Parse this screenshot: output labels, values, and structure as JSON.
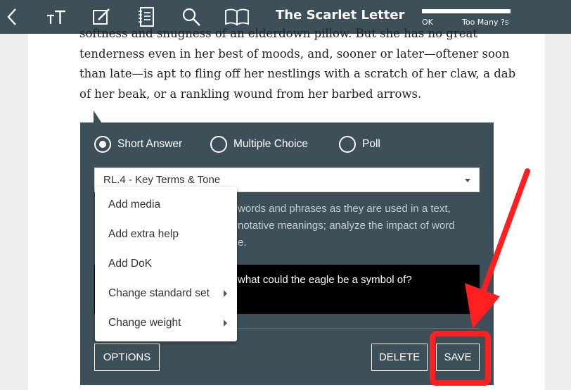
{
  "toolbar": {
    "title": "The Scarlet Letter",
    "icons": [
      "back-icon",
      "text-size-icon",
      "edit-icon",
      "notebook-icon",
      "search-icon",
      "book-icon"
    ],
    "meter": {
      "left_label": "OK",
      "right_label": "Too Many ?s",
      "level": 1.0
    }
  },
  "reading": {
    "lines": [
      "softness and snugness of an elderdown pillow. But she has no great",
      "tenderness even in her best of moods, and, sooner or later—oftener soon",
      "than late—is apt to fling off her nestlings with a scratch of her claw, a dab",
      "of her beak, or a rankling wound from her barbed arrows."
    ]
  },
  "question_editor": {
    "types": [
      {
        "label": "Short Answer",
        "selected": true
      },
      {
        "label": "Multiple Choice",
        "selected": false
      },
      {
        "label": "Poll",
        "selected": false
      }
    ],
    "standard": {
      "selected": "RL.4 - Key Terms & Tone"
    },
    "description_lines": [
      "words and phrases as they are used in a text,",
      "notative meanings; analyze the impact of word",
      "e."
    ],
    "prompt": "what could the eagle be a symbol of?",
    "buttons": {
      "options": "OPTIONS",
      "delete": "DELETE",
      "save": "SAVE"
    }
  },
  "options_menu": {
    "items": [
      {
        "label": "Add media",
        "has_submenu": false
      },
      {
        "label": "Add extra help",
        "has_submenu": false
      },
      {
        "label": "Add DoK",
        "has_submenu": false
      },
      {
        "label": "Change standard set",
        "has_submenu": true
      },
      {
        "label": "Change weight",
        "has_submenu": true
      }
    ]
  },
  "annotation": {
    "color": "#ff1f1f"
  },
  "colors": {
    "toolbar": "#3d4f59",
    "card": "#3d4f59",
    "prompt_bg": "#000000"
  }
}
